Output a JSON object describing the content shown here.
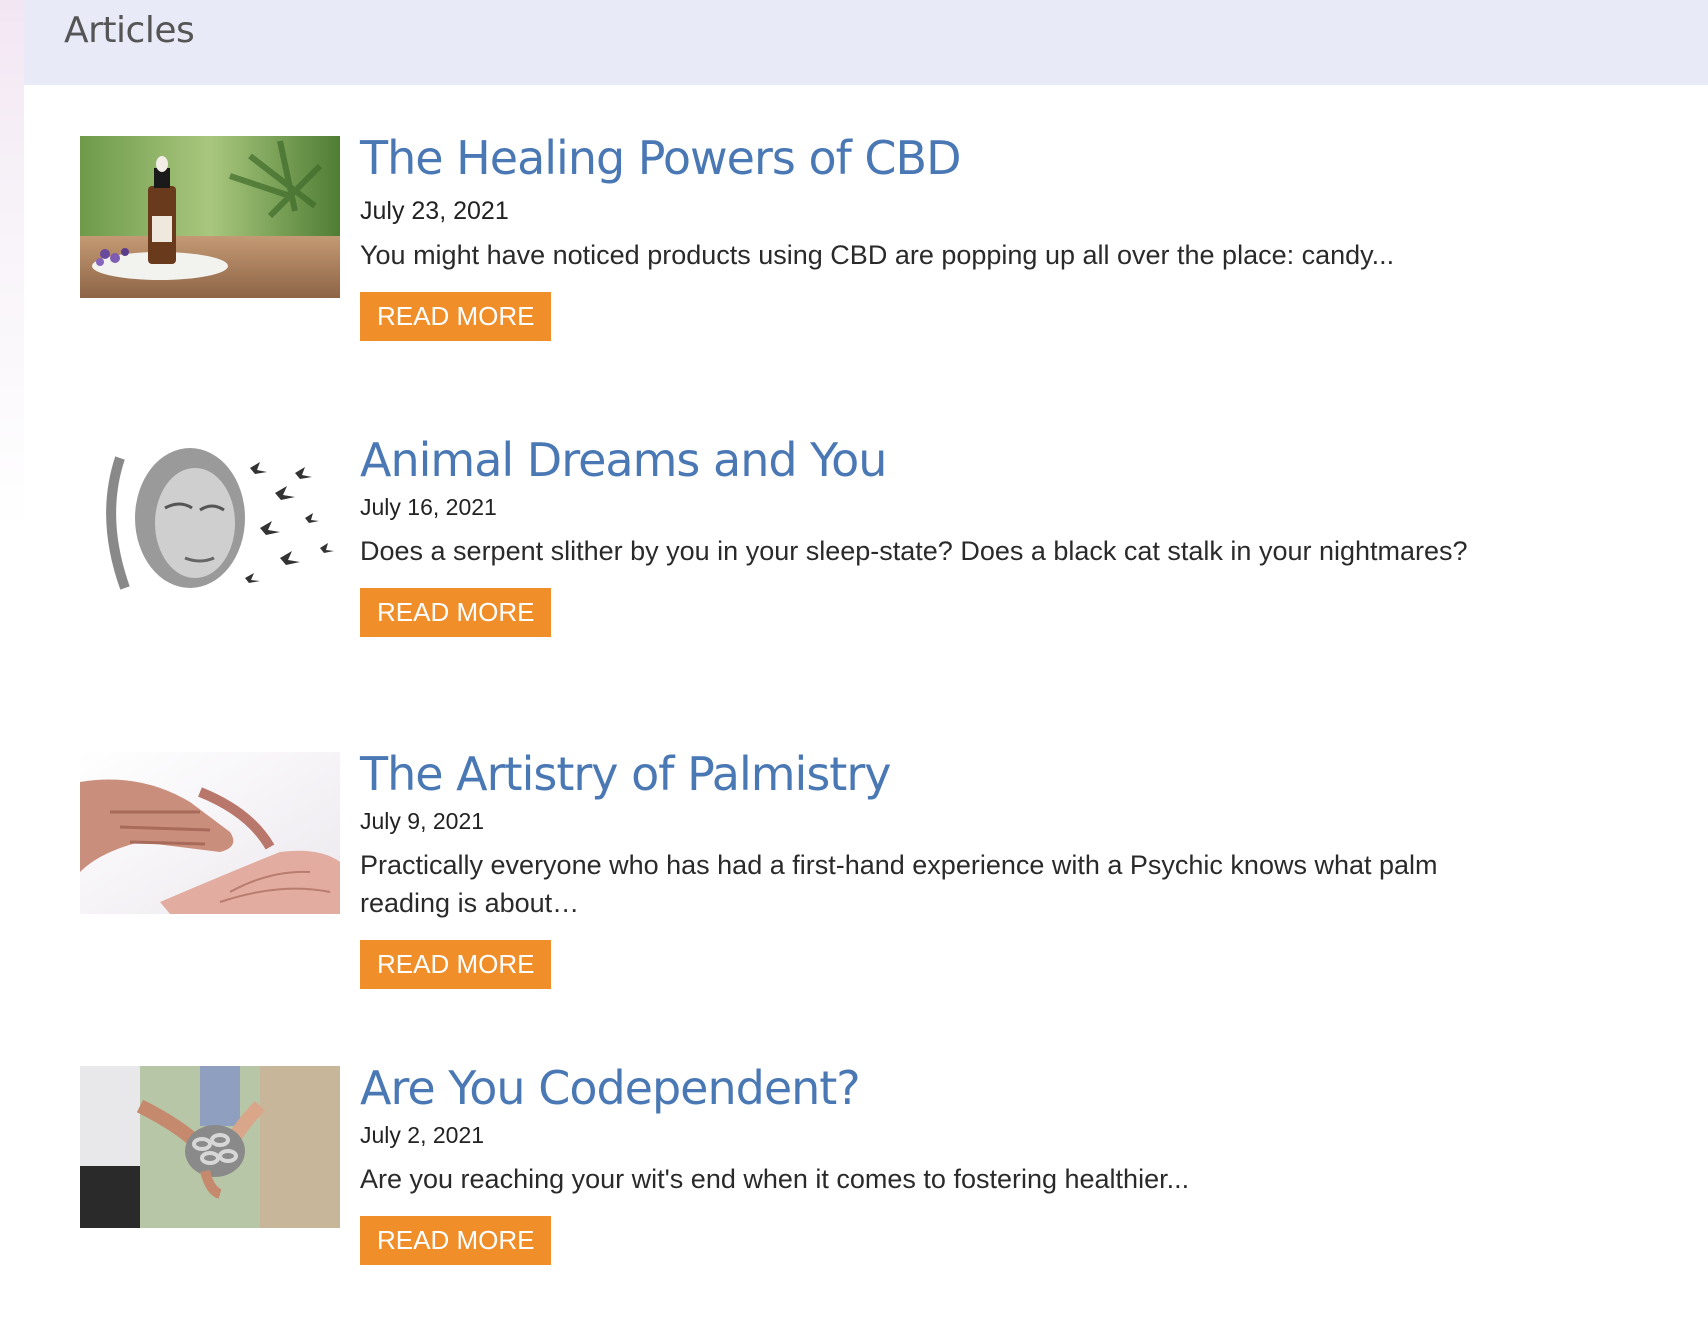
{
  "header": {
    "title": "Articles"
  },
  "articles": [
    {
      "title": "The Healing Powers of CBD",
      "date": "July 23, 2021",
      "excerpt": "You might have noticed products using CBD are popping up all over the place: candy...",
      "button": "READ MORE"
    },
    {
      "title": "Animal Dreams and You",
      "date": "July 16, 2021",
      "excerpt": "Does a serpent slither by you in your sleep-state? Does a black cat stalk in your nightmares?",
      "button": "READ MORE"
    },
    {
      "title": "The Artistry of Palmistry",
      "date": "July 9, 2021",
      "excerpt": "Practically everyone who has had a first-hand experience with a Psychic knows what palm reading is about…",
      "button": "READ MORE"
    },
    {
      "title": "Are You Codependent?",
      "date": "July 2, 2021",
      "excerpt": "Are you reaching your wit's end when it comes to fostering healthier...",
      "button": "READ MORE"
    }
  ],
  "colors": {
    "header_bg": "#e9eaf8",
    "title": "#4a78b4",
    "button": "#f08e2a"
  }
}
